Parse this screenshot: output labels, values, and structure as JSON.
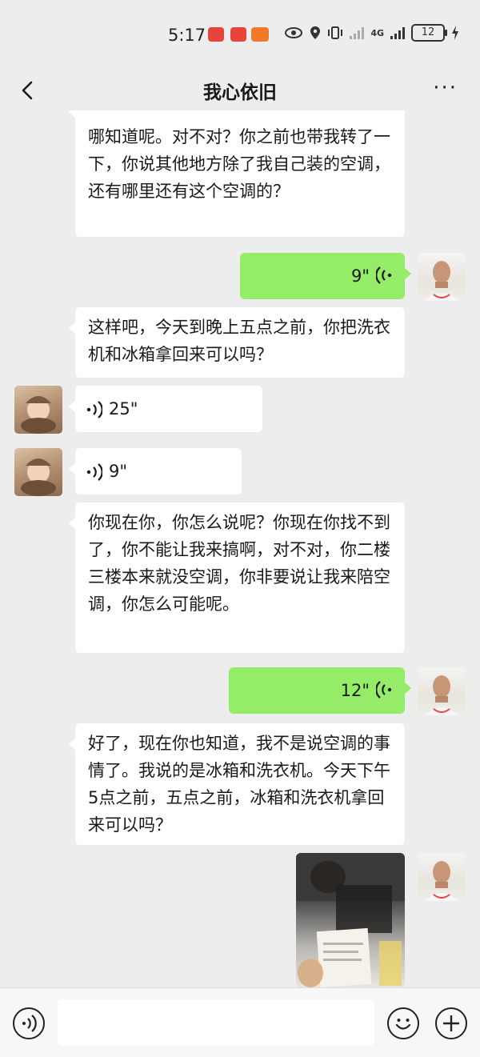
{
  "status": {
    "time": "5:17",
    "battery": "12",
    "network": "4G"
  },
  "nav": {
    "title": "我心依旧",
    "more_label": "···"
  },
  "messages": [
    {
      "side": "in",
      "type": "text",
      "text": "哪知道呢。对不对？你之前也带我转了一下，你说其他地方除了我自己装的空调，还有哪里还有这个空调的？"
    },
    {
      "side": "out",
      "type": "voice",
      "duration": "9\""
    },
    {
      "side": "in",
      "type": "text",
      "text": "这样吧，今天到晚上五点之前，你把洗衣机和冰箱拿回来可以吗？"
    },
    {
      "side": "in",
      "type": "voice",
      "duration": "25\""
    },
    {
      "side": "in",
      "type": "voice",
      "duration": "9\""
    },
    {
      "side": "in",
      "type": "text",
      "text": "你现在你，你怎么说呢？你现在你找不到了，你不能让我来搞啊，对不对，你二楼三楼本来就没空调，你非要说让我来陪空调，你怎么可能呢。"
    },
    {
      "side": "out",
      "type": "voice",
      "duration": "12\""
    },
    {
      "side": "in",
      "type": "text",
      "text": "好了，现在你也知道，我不是说空调的事情了。我说的是冰箱和洗衣机。今天下午5点之前，五点之前，冰箱和洗衣机拿回来可以吗？"
    },
    {
      "side": "out",
      "type": "image"
    }
  ],
  "colors": {
    "background": "#ededed",
    "bubble_out": "#95ec69",
    "bubble_in": "#ffffff"
  }
}
